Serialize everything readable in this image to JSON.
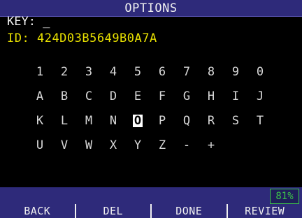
{
  "title": "OPTIONS",
  "key": {
    "label": "KEY:",
    "value": "_"
  },
  "id": {
    "label": "ID:",
    "value": "424D03B5649B0A7A"
  },
  "keyboard": {
    "rows": [
      [
        "1",
        "2",
        "3",
        "4",
        "5",
        "6",
        "7",
        "8",
        "9",
        "0"
      ],
      [
        "A",
        "B",
        "C",
        "D",
        "E",
        "F",
        "G",
        "H",
        "I",
        "J"
      ],
      [
        "K",
        "L",
        "M",
        "N",
        "O",
        "P",
        "Q",
        "R",
        "S",
        "T"
      ],
      [
        "U",
        "V",
        "W",
        "X",
        "Y",
        "Z",
        "-",
        "+"
      ]
    ],
    "selected": "O"
  },
  "battery": "81%",
  "softkeys": [
    "BACK",
    "DEL",
    "DONE",
    "REVIEW"
  ],
  "colors": {
    "bar": "#2e2a7a",
    "id_text": "#e8e000",
    "battery": "#3cc24a"
  }
}
